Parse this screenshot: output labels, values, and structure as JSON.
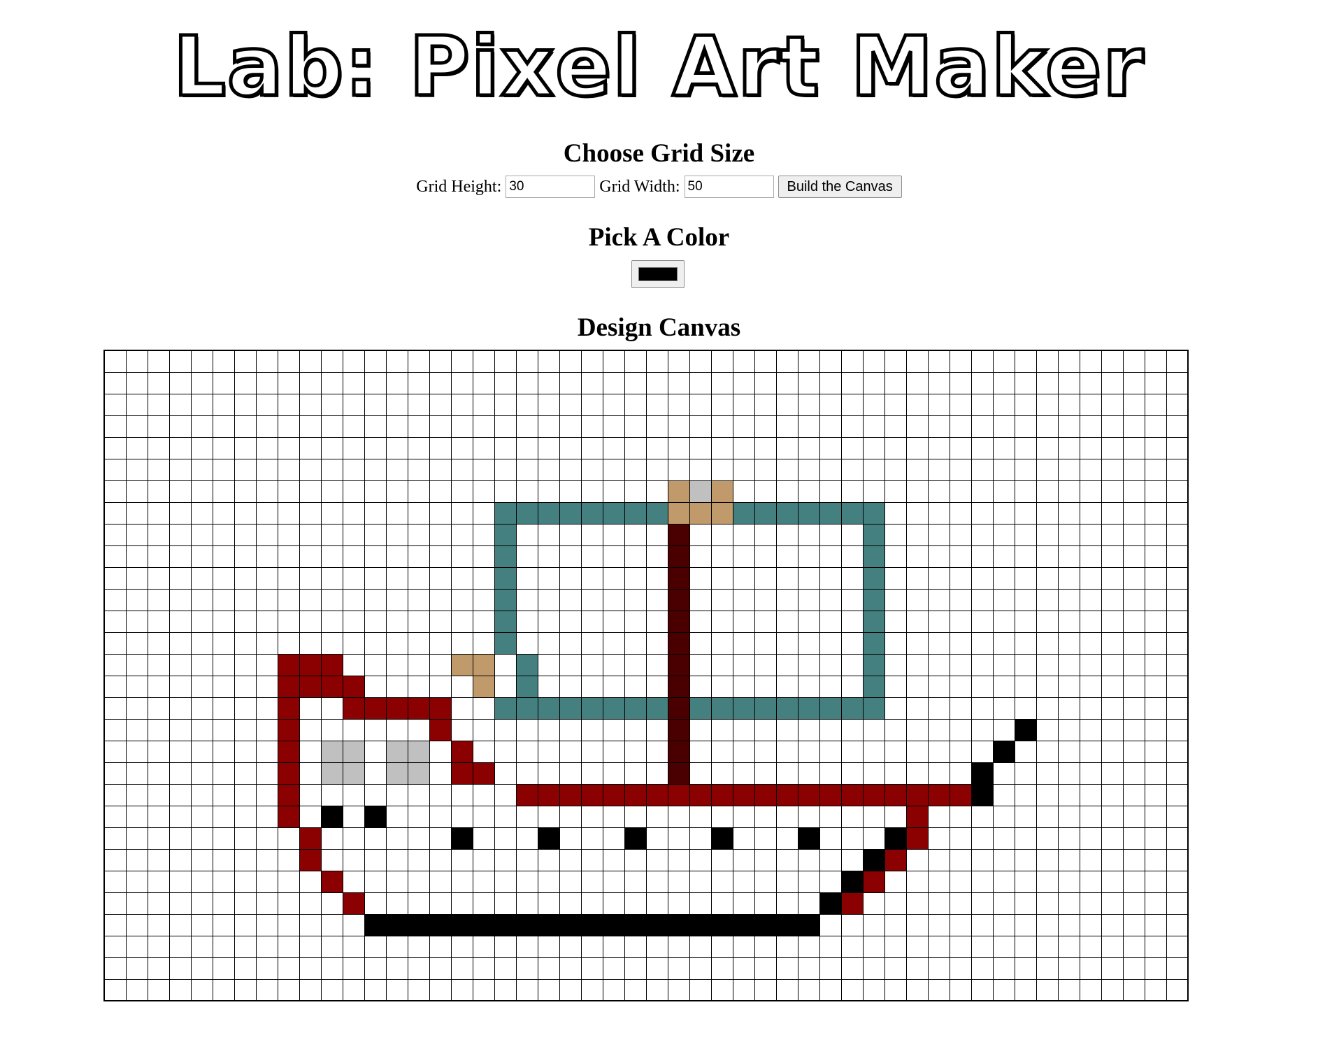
{
  "page": {
    "title": "Lab: Pixel Art Maker"
  },
  "grid_size": {
    "heading": "Choose Grid Size",
    "height_label": "Grid Height:",
    "height_value": "30",
    "width_label": "Grid Width:",
    "width_value": "50",
    "build_button": "Build the Canvas"
  },
  "color_picker": {
    "heading": "Pick A Color",
    "value": "#000000"
  },
  "canvas": {
    "heading": "Design Canvas",
    "rows": 30,
    "cols": 50,
    "palette": {
      "0": "#ffffff",
      "R": "#8b0000",
      "B": "#000000",
      "G": "#c0c0c0",
      "T": "#c19a6b",
      "E": "#458080",
      "M": "#4a0000"
    },
    "pixels": [
      "..................................................",
      "..................................................",
      "..................................................",
      "..................................................",
      "..................................................",
      "..................................................",
      "..........................TGT.....................",
      "..................EEEEEEEETTTEEEEEEE..............",
      "..................E.......M........E..............",
      "..................E.......M........E..............",
      "..................E.......M........E..............",
      "..................E.......M........E..............",
      "..................E.......M........E..............",
      "..................E.......M........E..............",
      "........RRR.....TT.E......M........E..............",
      "........RRRR.....T.E......M........E..............",
      "........R..RRRRR..EEEEEEEEMEEEEEEEEE..............",
      "........R......R..........M...............B.......",
      "........R.GG.GG.R.........M..............B........",
      "........R.GG.GG.RR........M.............B.........",
      "........R..........RRRRRRRRRRRRRRRRRRRRRB.........",
      "........R.B.B........................R............",
      ".........R......B...B...B...B...B...BR............",
      ".........R.........................BR.............",
      "..........R.......................BR..............",
      "...........R.....................BR...............",
      "............BBBBBBBBBBBBBBBBBBBBB.................",
      "..................................................",
      "..................................................",
      ".................................................."
    ]
  }
}
